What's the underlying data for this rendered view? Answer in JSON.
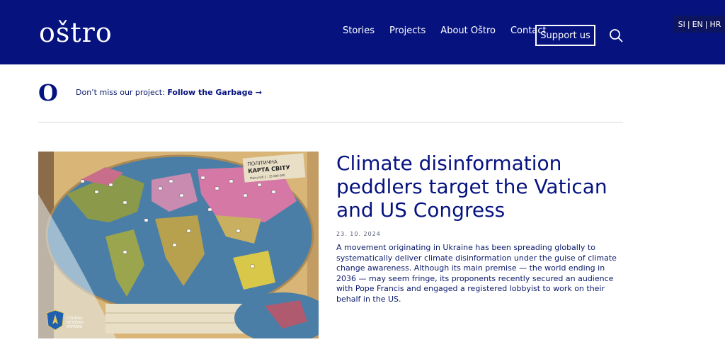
{
  "header": {
    "logo": "oštro",
    "nav": [
      "Stories",
      "Projects",
      "About Oštro",
      "Contact"
    ],
    "support_label": "Support us",
    "languages": [
      "SI",
      "EN",
      "HR"
    ],
    "bg_color": "#06137f"
  },
  "promo": {
    "mark": "O",
    "text": "Don’t miss our project: ",
    "link": "Follow the Garbage →"
  },
  "article": {
    "title": "Climate disinformation peddlers target the Vatican and US Congress",
    "date": "23. 10. 2024",
    "excerpt": "A movement originating in Ukraine has been spreading globally to systematically deliver climate disinformation under the guise of climate change awareness. Although its main premise — the world ending in 2036 — may seem fringe, its proponents recently secured an audience with Pope Francis and engaged a registered lobbyist to work on their behalf in the US.",
    "image": {
      "map_title_line1": "ПОЛІТИЧНА",
      "map_title_line2": "КАРТА СВІТУ",
      "map_scale": "Масштаб 1 : 35 000 000",
      "emblem_line1": "СЛУЖБА",
      "emblem_line2": "БЕЗПЕКИ",
      "emblem_line3": "УКРАЇНИ"
    }
  }
}
